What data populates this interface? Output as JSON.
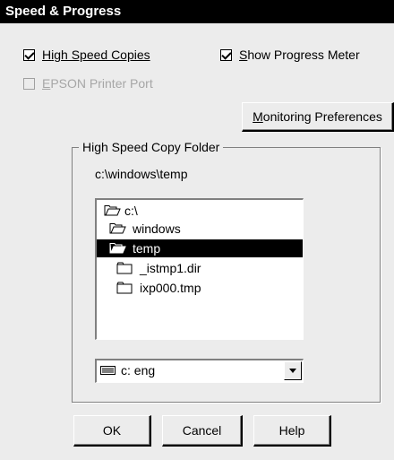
{
  "window": {
    "title": "Speed & Progress"
  },
  "options": {
    "high_speed_copies": {
      "pre": "",
      "u": "H",
      "post": "igh Speed Copies",
      "checked": true
    },
    "show_progress_meter": {
      "pre": "",
      "u": "S",
      "post": "how Progress Meter",
      "checked": true
    },
    "epson_printer_port": {
      "pre": "",
      "u": "E",
      "post": "PSON Printer Port",
      "checked": false,
      "disabled": true
    }
  },
  "monitoring_button": {
    "u": "M",
    "post": "onitoring Preferences"
  },
  "folder_group": {
    "label": "High Speed Copy Folder",
    "current_path": "c:\\windows\\temp",
    "tree": [
      {
        "name": "c:\\",
        "icon": "open-folder-icon"
      },
      {
        "name": "windows",
        "icon": "open-folder-icon"
      },
      {
        "name": "temp",
        "icon": "open-folder-icon",
        "selected": true
      },
      {
        "name": "_istmp1.dir",
        "icon": "closed-folder-icon"
      },
      {
        "name": "ixp000.tmp",
        "icon": "closed-folder-icon"
      }
    ],
    "drive": {
      "value": "c: eng",
      "icon": "drive-icon"
    }
  },
  "buttons": {
    "ok": "OK",
    "cancel": "Cancel",
    "help": "Help"
  }
}
